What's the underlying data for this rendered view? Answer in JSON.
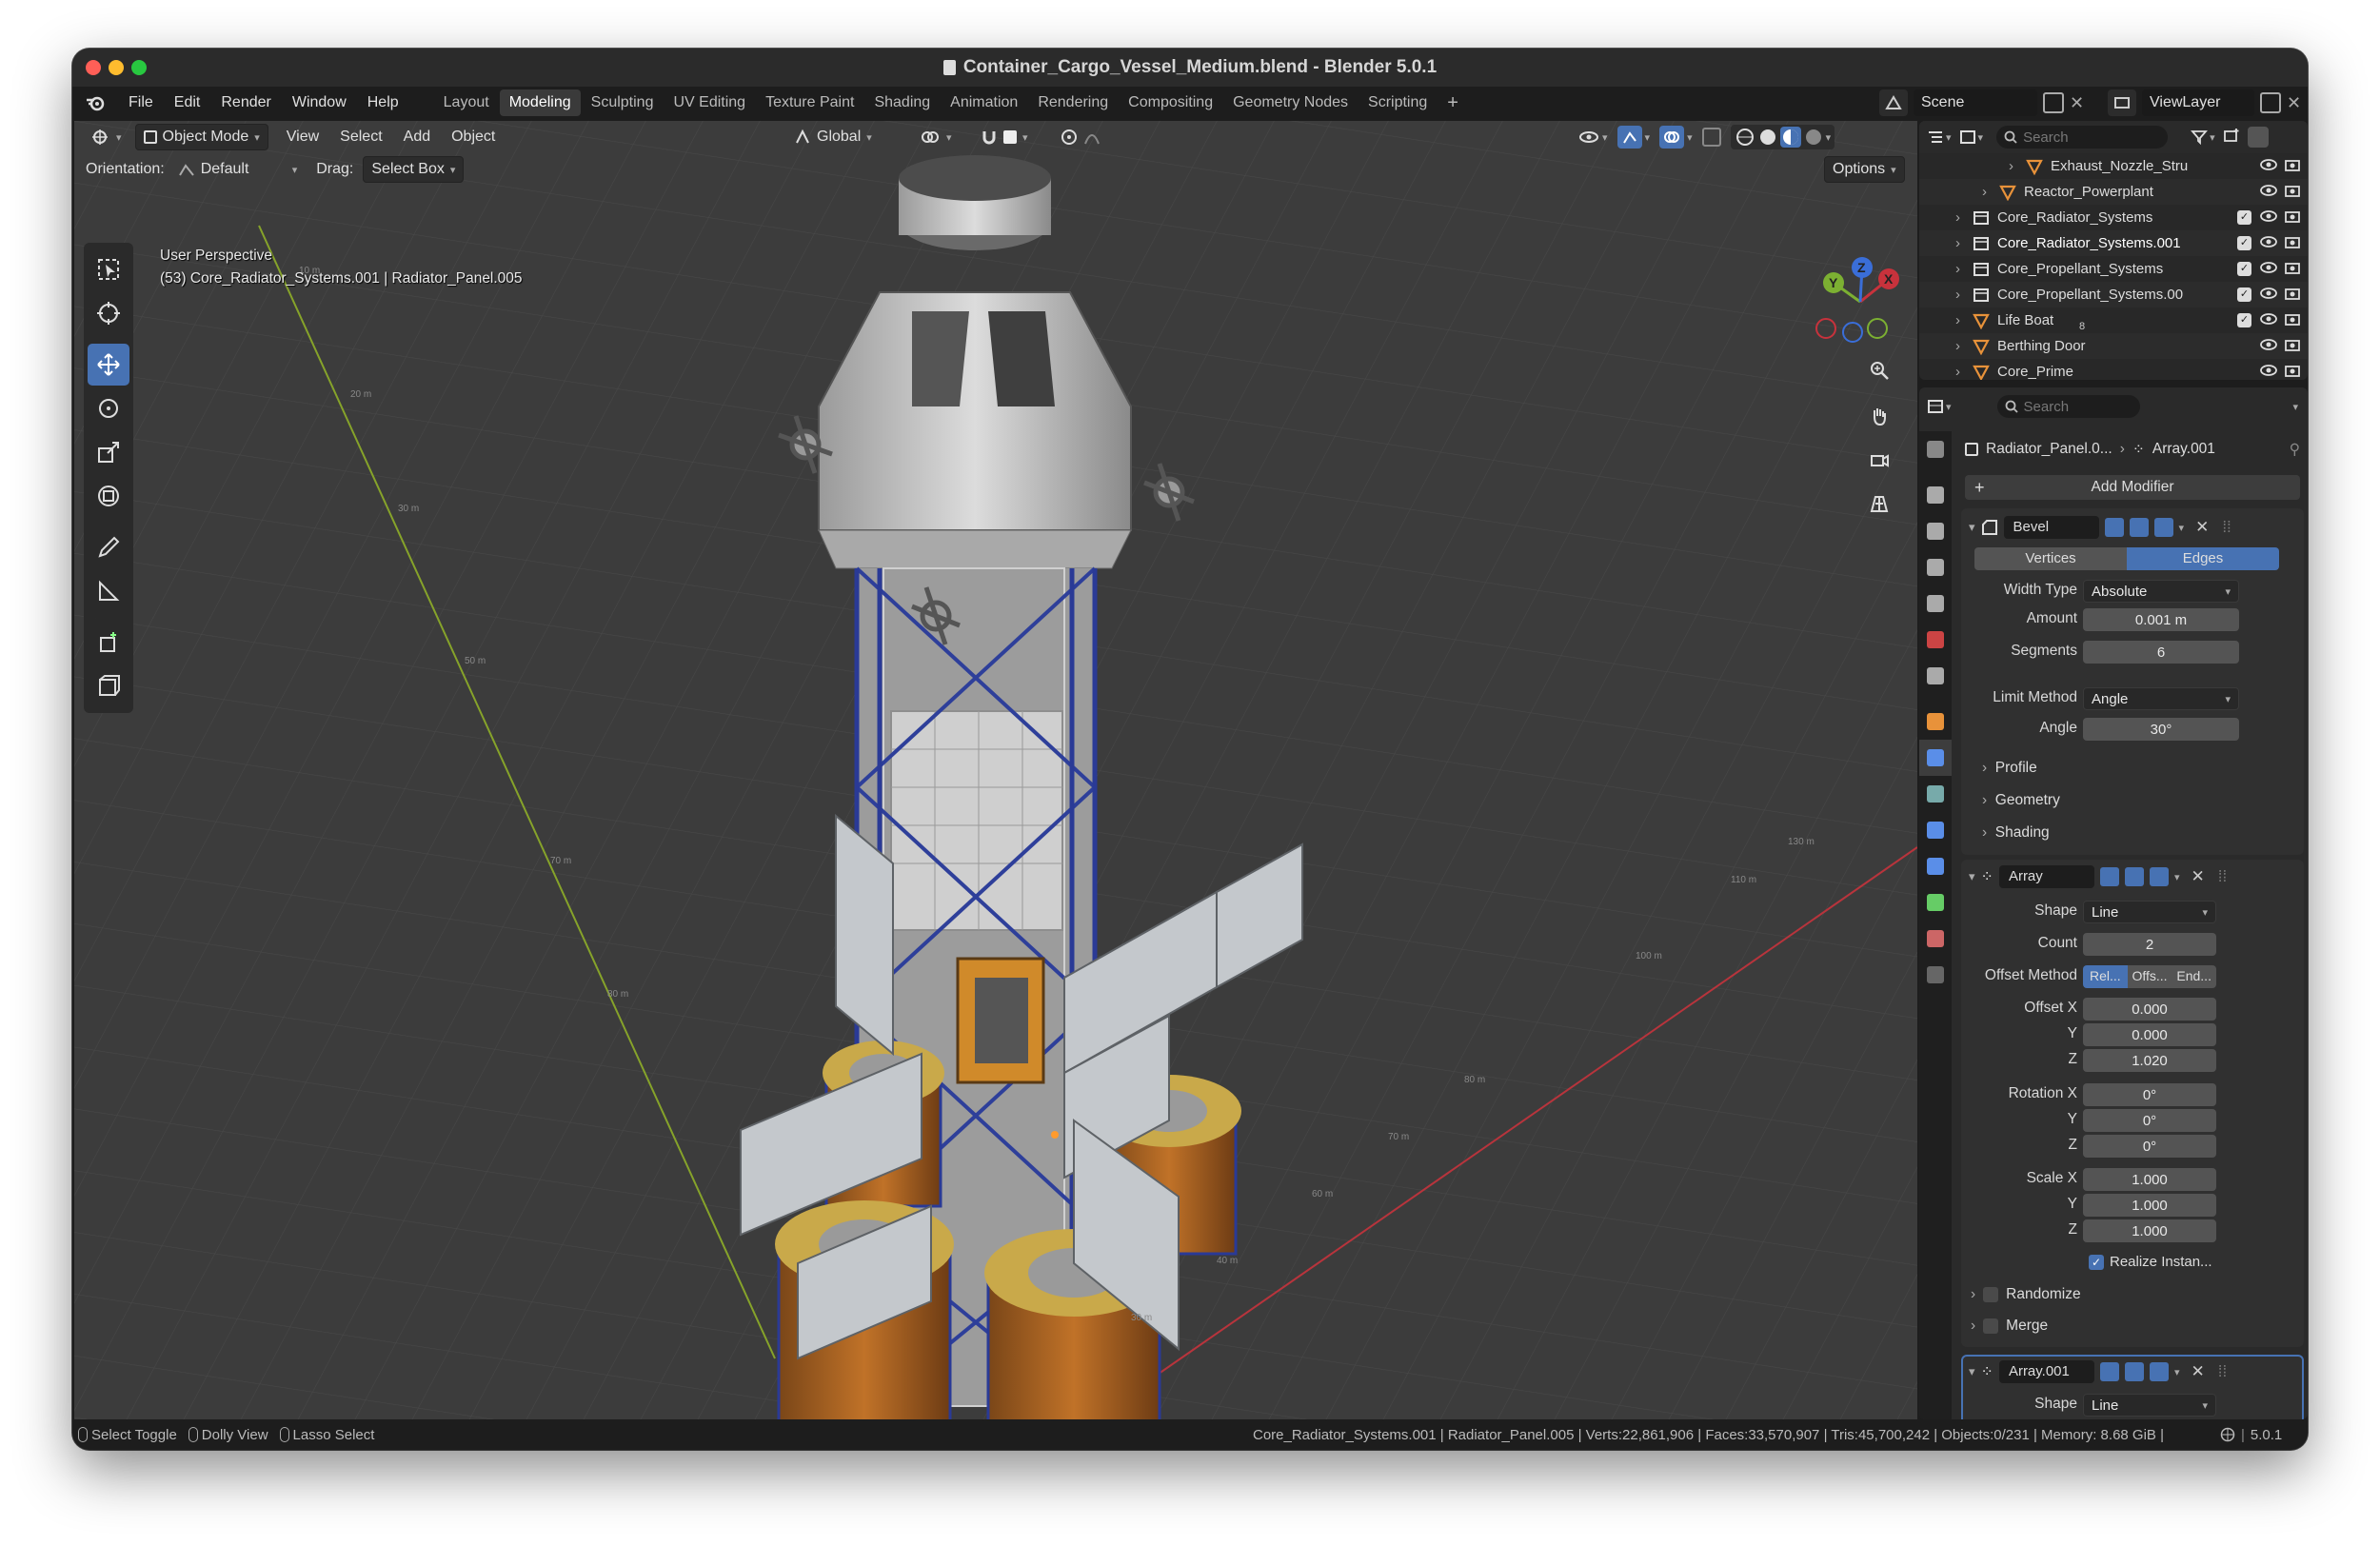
{
  "window": {
    "title": "Container_Cargo_Vessel_Medium.blend - Blender 5.0.1"
  },
  "menu": [
    "File",
    "Edit",
    "Render",
    "Window",
    "Help"
  ],
  "workspaces": [
    "Layout",
    "Modeling",
    "Sculpting",
    "UV Editing",
    "Texture Paint",
    "Shading",
    "Animation",
    "Rendering",
    "Compositing",
    "Geometry Nodes",
    "Scripting"
  ],
  "active_workspace": "Modeling",
  "top_right": {
    "scene": "Scene",
    "viewlayer": "ViewLayer",
    "add": "+"
  },
  "viewport": {
    "mode": "Object Mode",
    "menus": [
      "View",
      "Select",
      "Add",
      "Object"
    ],
    "transform_orientation": "Global",
    "orientation_label": "Orientation:",
    "orientation_value": "Default",
    "drag_label": "Drag:",
    "drag_value": "Select Box",
    "options": "Options",
    "overlay_line1": "User Perspective",
    "overlay_line2": "(53) Core_Radiator_Systems.001 | Radiator_Panel.005",
    "gizmo": {
      "x": "X",
      "y": "Y",
      "z": "Z"
    }
  },
  "outliner": {
    "search_placeholder": "Search",
    "rows": [
      {
        "label": "Exhaust_Nozzle_Stru",
        "indent": 2,
        "icon": "mesh"
      },
      {
        "label": "Reactor_Powerplant",
        "indent": 1,
        "icon": "mesh"
      },
      {
        "label": "Core_Radiator_Systems",
        "indent": 0,
        "icon": "collection",
        "check": true
      },
      {
        "label": "Core_Radiator_Systems.001",
        "indent": 0,
        "icon": "collection",
        "check": true,
        "selected": true
      },
      {
        "label": "Core_Propellant_Systems",
        "indent": 0,
        "icon": "collection",
        "check": true
      },
      {
        "label": "Core_Propellant_Systems.00",
        "indent": 0,
        "icon": "collection",
        "check": true
      },
      {
        "label": "Life Boat",
        "indent": 0,
        "icon": "mesh",
        "check": true,
        "badge": "8"
      },
      {
        "label": "Berthing Door",
        "indent": 0,
        "icon": "mesh"
      },
      {
        "label": "Core_Prime",
        "indent": 0,
        "icon": "mesh"
      }
    ]
  },
  "properties": {
    "search_placeholder": "Search",
    "breadcrumb_object": "Radiator_Panel.0...",
    "breadcrumb_modifier": "Array.001",
    "add_modifier": "Add Modifier",
    "bevel": {
      "name": "Bevel",
      "tab_vertices": "Vertices",
      "tab_edges": "Edges",
      "width_type_label": "Width Type",
      "width_type": "Absolute",
      "amount_label": "Amount",
      "amount": "0.001 m",
      "segments_label": "Segments",
      "segments": "6",
      "limit_method_label": "Limit Method",
      "limit_method": "Angle",
      "angle_label": "Angle",
      "angle": "30°",
      "sub_profile": "Profile",
      "sub_geometry": "Geometry",
      "sub_shading": "Shading"
    },
    "array": {
      "name": "Array",
      "shape_label": "Shape",
      "shape": "Line",
      "count_label": "Count",
      "count": "2",
      "offset_method_label": "Offset Method",
      "offset_methods": [
        "Rel...",
        "Offs...",
        "End..."
      ],
      "offset_x_label": "Offset X",
      "offset_x": "0.000",
      "y_label": "Y",
      "z_label": "Z",
      "offset_y": "0.000",
      "offset_z": "1.020",
      "rotation_x_label": "Rotation X",
      "rotation_x": "0°",
      "rotation_y": "0°",
      "rotation_z": "0°",
      "scale_x_label": "Scale X",
      "scale_x": "1.000",
      "scale_y": "1.000",
      "scale_z": "1.000",
      "realize": "Realize Instan...",
      "randomize": "Randomize",
      "merge": "Merge"
    },
    "array2": {
      "name": "Array.001",
      "shape_label": "Shape",
      "shape": "Line"
    }
  },
  "status": {
    "select_toggle": "Select Toggle",
    "dolly_view": "Dolly View",
    "lasso_select": "Lasso Select",
    "stats": "Core_Radiator_Systems.001 | Radiator_Panel.005 | Verts:22,861,906 | Faces:33,570,907 | Tris:45,700,242 | Objects:0/231 | Memory: 8.68 GiB |",
    "version": "5.0.1"
  },
  "colors": {
    "accent": "#4772b3",
    "x_axis": "#c8323c",
    "y_axis": "#7cb032",
    "z_axis": "#3a6ed8"
  }
}
